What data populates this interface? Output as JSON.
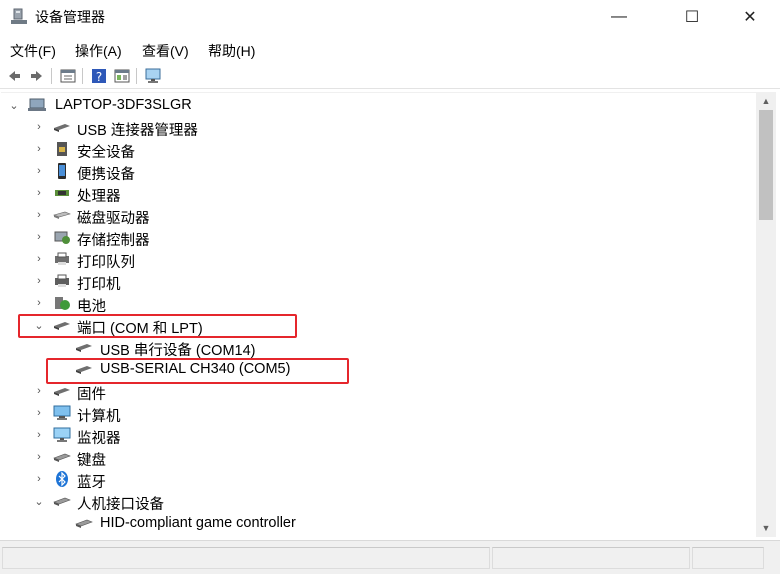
{
  "window": {
    "title": "设备管理器",
    "min_glyph": "—",
    "max_glyph": "☐",
    "close_glyph": "✕"
  },
  "menu": {
    "items": [
      "文件(F)",
      "操作(A)",
      "查看(V)",
      "帮助(H)"
    ]
  },
  "toolbar": {
    "buttons": [
      "back-icon",
      "forward-icon",
      "properties-icon",
      "help-icon",
      "show-hide-icon",
      "monitor-icon"
    ]
  },
  "tree": {
    "root": "LAPTOP-3DF3SLGR",
    "nodes": [
      {
        "label": "USB 连接器管理器",
        "expanded": false
      },
      {
        "label": "安全设备",
        "expanded": false
      },
      {
        "label": "便携设备",
        "expanded": false
      },
      {
        "label": "处理器",
        "expanded": false
      },
      {
        "label": "磁盘驱动器",
        "expanded": false
      },
      {
        "label": "存储控制器",
        "expanded": false
      },
      {
        "label": "打印队列",
        "expanded": false
      },
      {
        "label": "打印机",
        "expanded": false
      },
      {
        "label": "电池",
        "expanded": false
      },
      {
        "label": "端口 (COM 和 LPT)",
        "expanded": true,
        "highlighted": true
      },
      {
        "label": "USB 串行设备 (COM14)",
        "child": true
      },
      {
        "label": "USB-SERIAL CH340 (COM5)",
        "child": true,
        "highlighted": true
      },
      {
        "label": "固件",
        "expanded": false
      },
      {
        "label": "计算机",
        "expanded": false
      },
      {
        "label": "监视器",
        "expanded": false
      },
      {
        "label": "键盘",
        "expanded": false
      },
      {
        "label": "蓝牙",
        "expanded": false
      },
      {
        "label": "人机接口设备",
        "expanded": true
      },
      {
        "label": "HID-compliant game controller",
        "child": true
      }
    ]
  },
  "colors": {
    "highlight_box": "#e5262c"
  }
}
